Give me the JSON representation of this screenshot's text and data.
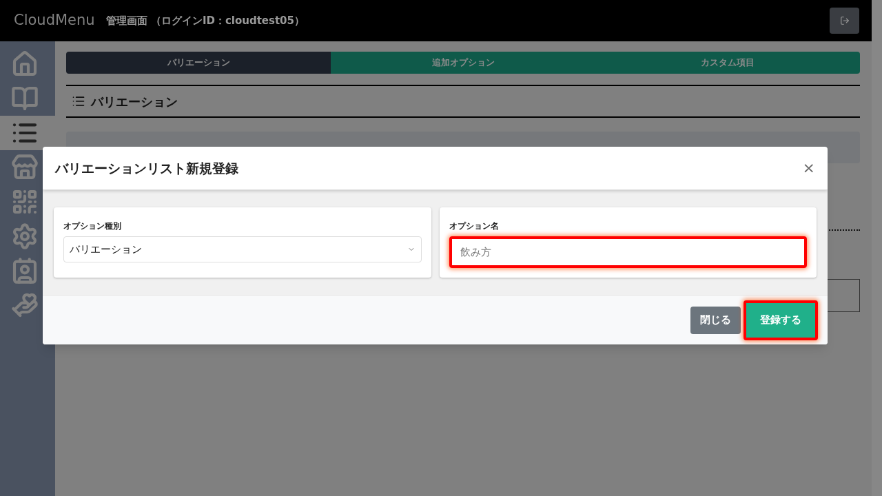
{
  "header": {
    "logo": "CloudMenu",
    "title": "管理画面 （ログインID：cloudtest05）"
  },
  "sidebar": {
    "items": [
      {
        "kind": "home",
        "selected": false
      },
      {
        "kind": "book",
        "selected": false
      },
      {
        "kind": "list",
        "selected": true
      },
      {
        "kind": "store",
        "selected": false
      },
      {
        "kind": "qr",
        "selected": false
      },
      {
        "kind": "settings",
        "selected": false
      },
      {
        "kind": "card",
        "selected": false
      },
      {
        "kind": "care",
        "selected": false
      }
    ]
  },
  "tabs": [
    {
      "label": "バリエーション",
      "selected": true
    },
    {
      "label": "追加オプション",
      "selected": false
    },
    {
      "label": "カスタム項目",
      "selected": false
    }
  ],
  "section_title": "バリエーション",
  "dialog": {
    "title": "バリエーションリスト新規登録",
    "close": "×",
    "fields": [
      {
        "kind": "select",
        "label": "オプション種別",
        "value": "バリエーション",
        "highlighted": false
      },
      {
        "kind": "text",
        "label": "オプション名",
        "placeholder": "飲み方",
        "highlighted": true
      }
    ],
    "buttons": [
      {
        "label": "閉じる",
        "kind": "secondary",
        "highlighted": false
      },
      {
        "label": "登録する",
        "kind": "primary",
        "highlighted": true
      }
    ]
  }
}
